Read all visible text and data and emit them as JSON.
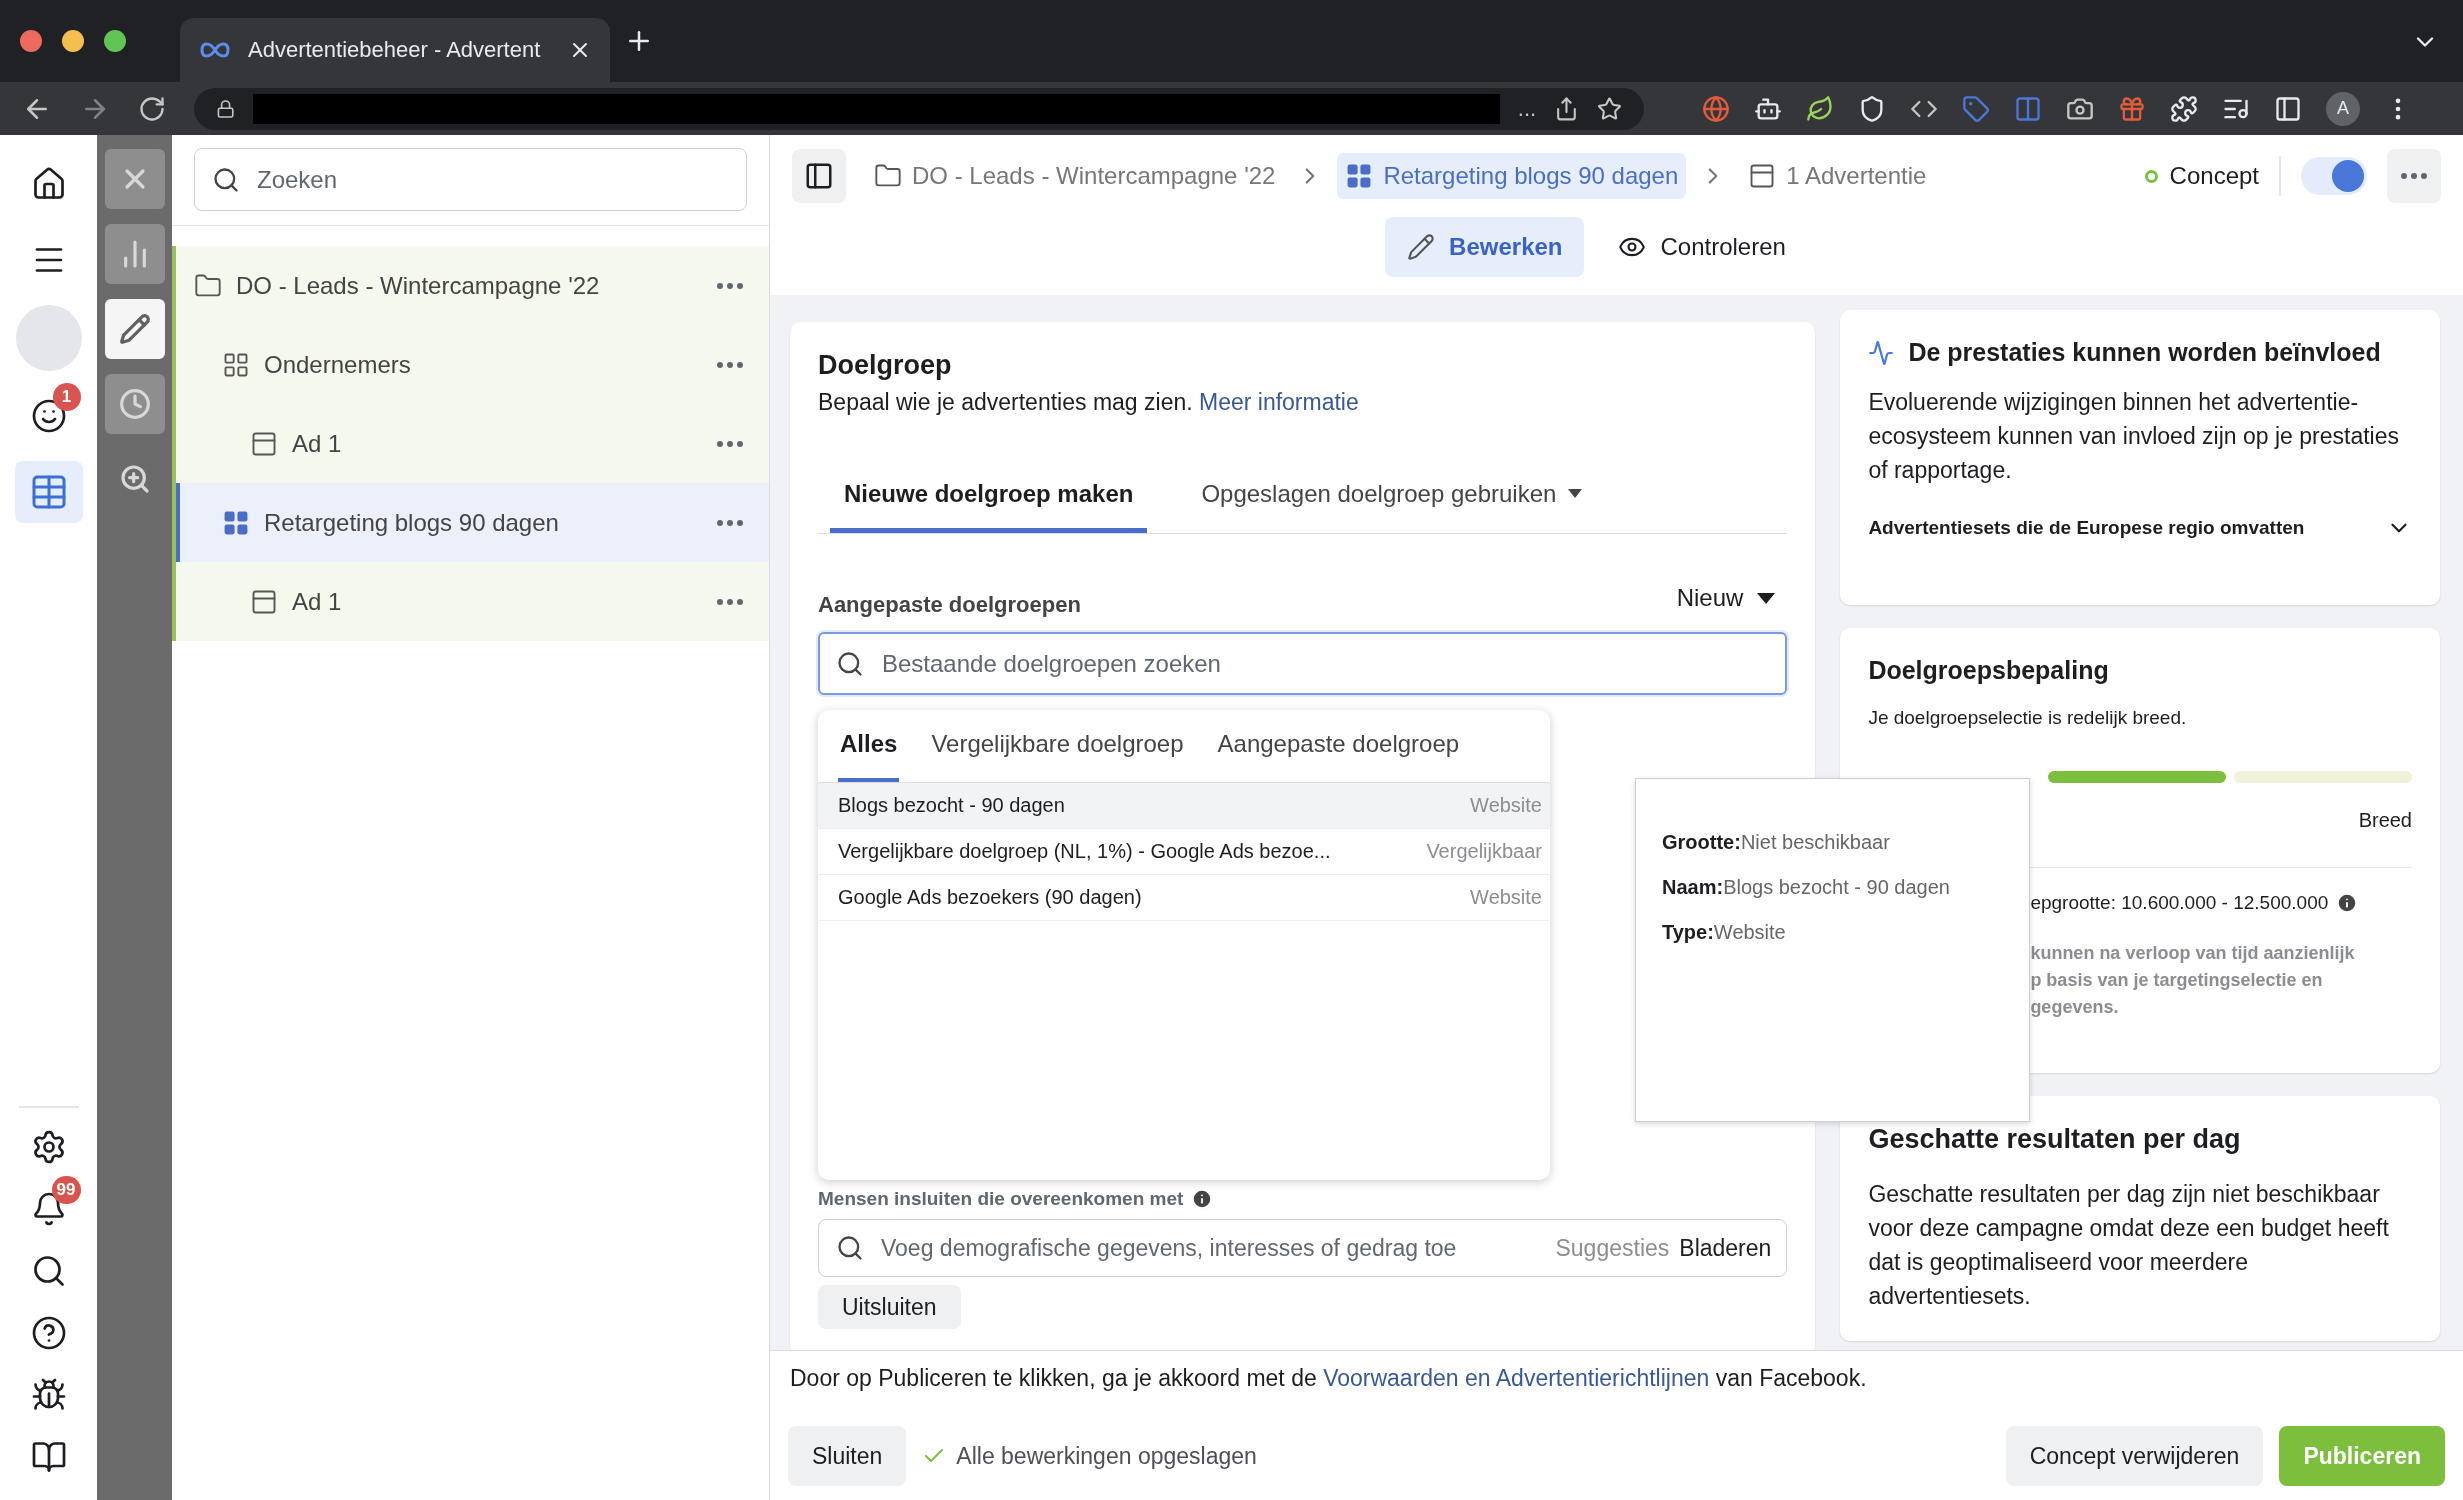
{
  "browser": {
    "tab_title": "Advertentiebeheer - Advertent",
    "url_tail": "...",
    "profile": "A"
  },
  "rail": {
    "top": [
      {
        "kind": "home",
        "selected": false
      },
      {
        "kind": "menu",
        "selected": false
      },
      {
        "kind": "avatar",
        "selected": false
      },
      {
        "kind": "face",
        "selected": false,
        "badge": "1"
      },
      {
        "kind": "table",
        "selected": true
      }
    ],
    "bottom": [
      {
        "kind": "settings",
        "selected": false
      },
      {
        "kind": "bell",
        "selected": false,
        "badge": "99"
      },
      {
        "kind": "search",
        "selected": false
      },
      {
        "kind": "help",
        "selected": false
      },
      {
        "kind": "bug",
        "selected": false
      },
      {
        "kind": "panel",
        "selected": false
      }
    ]
  },
  "tools": [
    {
      "kind": "close",
      "selected": false
    },
    {
      "kind": "chart",
      "selected": false
    },
    {
      "kind": "edit",
      "selected": true
    },
    {
      "kind": "history",
      "selected": false
    },
    {
      "kind": "zoom",
      "selected": false
    }
  ],
  "tree": {
    "search_placeholder": "Zoeken",
    "items": [
      {
        "kind": "campaign",
        "label": "DO - Leads - Wintercampagne '22",
        "selected": false,
        "children": [
          {
            "kind": "adset",
            "label": "Ondernemers",
            "selected": false,
            "children": [
              {
                "kind": "ad",
                "label": "Ad 1",
                "selected": false
              }
            ]
          },
          {
            "kind": "adset",
            "label": "Retargeting blogs 90 dagen",
            "selected": true,
            "children": [
              {
                "kind": "ad",
                "label": "Ad 1",
                "selected": false
              }
            ]
          }
        ]
      }
    ]
  },
  "header": {
    "breadcrumbs": [
      {
        "kind": "campaign",
        "label": "DO - Leads - Wintercampagne '22",
        "selected": false
      },
      {
        "kind": "adset",
        "label": "Retargeting blogs 90 dagen",
        "selected": true
      },
      {
        "kind": "ad",
        "label": "1 Advertentie",
        "selected": false
      }
    ],
    "status": {
      "label": "Concept",
      "color": "#7cbf3c"
    },
    "toggle": {
      "on": true
    },
    "modes": [
      {
        "kind": "edit",
        "label": "Bewerken",
        "selected": true
      },
      {
        "kind": "review",
        "label": "Controleren",
        "selected": false
      }
    ]
  },
  "audience": {
    "title": "Doelgroep",
    "description": "Bepaal wie je advertenties mag zien.",
    "link": "Meer informatie",
    "tabs": [
      {
        "label": "Nieuwe doelgroep maken",
        "selected": true,
        "dropdown": false
      },
      {
        "label": "Opgeslagen doelgroep gebruiken",
        "selected": false,
        "dropdown": true
      }
    ],
    "custom": {
      "label": "Aangepaste doelgroepen",
      "new_button": "Nieuw",
      "placeholder": "Bestaande doelgroepen zoeken"
    },
    "dropdown": {
      "tabs": [
        {
          "label": "Alles",
          "selected": true
        },
        {
          "label": "Vergelijkbare doelgroep",
          "selected": false
        },
        {
          "label": "Aangepaste doelgroep",
          "selected": false
        }
      ],
      "rows": [
        {
          "name": "Blogs bezocht - 90 dagen",
          "type": "Website",
          "highlighted": true
        },
        {
          "name": "Vergelijkbare doelgroep (NL, 1%) - Google Ads bezoe...",
          "type": "Vergelijkbaar",
          "highlighted": false
        },
        {
          "name": "Google Ads bezoekers (90 dagen)",
          "type": "Website",
          "highlighted": false
        }
      ]
    },
    "include": {
      "label": "Mensen insluiten die overeenkomen met",
      "placeholder": "Voeg demografische gegevens, interesses of gedrag toe",
      "suggestions": "Suggesties",
      "browse": "Bladeren"
    },
    "exclude_button": "Uitsluiten"
  },
  "tooltip": {
    "rows": [
      "**Grootte:**Niet beschikbaar",
      "**Naam:**Blogs bezocht - 90 dagen",
      "**Type:**Website"
    ]
  },
  "performance": {
    "title": "De prestaties kunnen worden beïnvloed",
    "text": "Evoluerende wijzigingen binnen het advertentie-ecosysteem kunnen van invloed zijn op je prestaties of rapportage.",
    "accordion": {
      "label": "Advertentiesets die de Europese regio omvatten",
      "expanded": false
    }
  },
  "definition": {
    "title": "Doelgroepsbepaling",
    "text": "Je doelgroepselectie is redelijk breed.",
    "segments": [
      {
        "active": true
      },
      {
        "active": false
      }
    ],
    "meter_label": "Breed",
    "size": "epgrootte: 10.600.000 - 12.500.000",
    "note_lines": [
      "kunnen na verloop van tijd aanzienlijk",
      "p basis van je targetingselectie en",
      "gegevens."
    ]
  },
  "estimate": {
    "title": "Geschatte resultaten per dag",
    "text": "Geschatte resultaten per dag zijn niet beschikbaar voor deze campagne omdat deze een budget heeft dat is geoptimaliseerd voor meerdere advertentiesets."
  },
  "footer": {
    "notice_before": "Door op Publiceren te klikken, ga je akkoord met de",
    "notice_link": "Voorwaarden en Advertentierichtlijnen",
    "notice_after": "van Facebook.",
    "close": "Sluiten",
    "saved": "Alle bewerkingen opgeslagen",
    "delete": "Concept verwijderen",
    "publish": "Publiceren"
  }
}
